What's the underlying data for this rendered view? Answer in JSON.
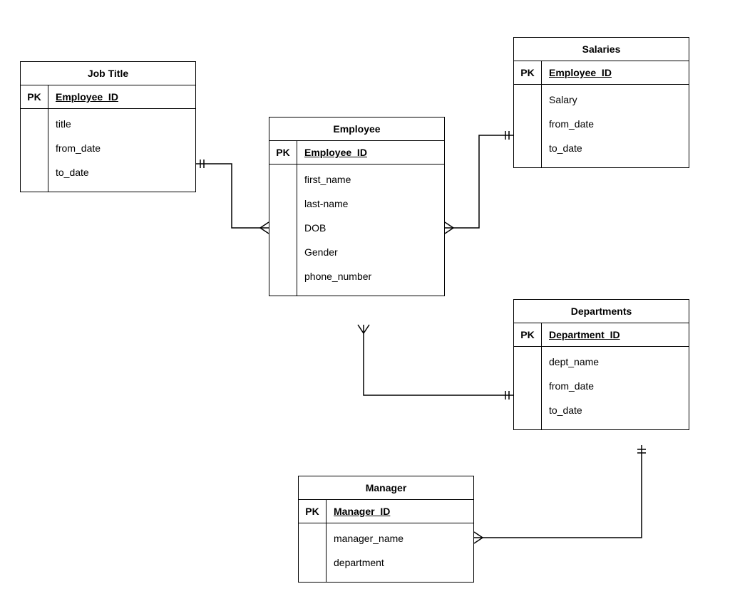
{
  "entities": {
    "jobTitle": {
      "title": "Job Title",
      "pkLabel": "PK",
      "pkField": "Employee_ID",
      "attrs": [
        "title",
        "from_date",
        "to_date"
      ]
    },
    "employee": {
      "title": "Employee",
      "pkLabel": "PK",
      "pkField": "Employee_ID",
      "attrs": [
        "first_name",
        "last-name",
        "DOB",
        "Gender",
        "phone_number"
      ]
    },
    "salaries": {
      "title": "Salaries",
      "pkLabel": "PK",
      "pkField": "Employee_ID",
      "attrs": [
        "Salary",
        "from_date",
        "to_date"
      ]
    },
    "departments": {
      "title": "Departments",
      "pkLabel": "PK",
      "pkField": "Department_ID",
      "attrs": [
        "dept_name",
        "from_date",
        "to_date"
      ]
    },
    "manager": {
      "title": "Manager",
      "pkLabel": "PK",
      "pkField": "Manager_ID",
      "attrs": [
        "manager_name",
        "department"
      ]
    }
  },
  "chart_data": {
    "type": "entity-relationship",
    "entities": [
      {
        "name": "Job Title",
        "pk": "Employee_ID",
        "attributes": [
          "title",
          "from_date",
          "to_date"
        ]
      },
      {
        "name": "Employee",
        "pk": "Employee_ID",
        "attributes": [
          "first_name",
          "last-name",
          "DOB",
          "Gender",
          "phone_number"
        ]
      },
      {
        "name": "Salaries",
        "pk": "Employee_ID",
        "attributes": [
          "Salary",
          "from_date",
          "to_date"
        ]
      },
      {
        "name": "Departments",
        "pk": "Department_ID",
        "attributes": [
          "dept_name",
          "from_date",
          "to_date"
        ]
      },
      {
        "name": "Manager",
        "pk": "Manager_ID",
        "attributes": [
          "manager_name",
          "department"
        ]
      }
    ],
    "relationships": [
      {
        "from": "Job Title",
        "to": "Employee",
        "from_card": "one",
        "to_card": "many"
      },
      {
        "from": "Salaries",
        "to": "Employee",
        "from_card": "one",
        "to_card": "many"
      },
      {
        "from": "Departments",
        "to": "Employee",
        "from_card": "one",
        "to_card": "many"
      },
      {
        "from": "Departments",
        "to": "Manager",
        "from_card": "one",
        "to_card": "many"
      }
    ]
  }
}
